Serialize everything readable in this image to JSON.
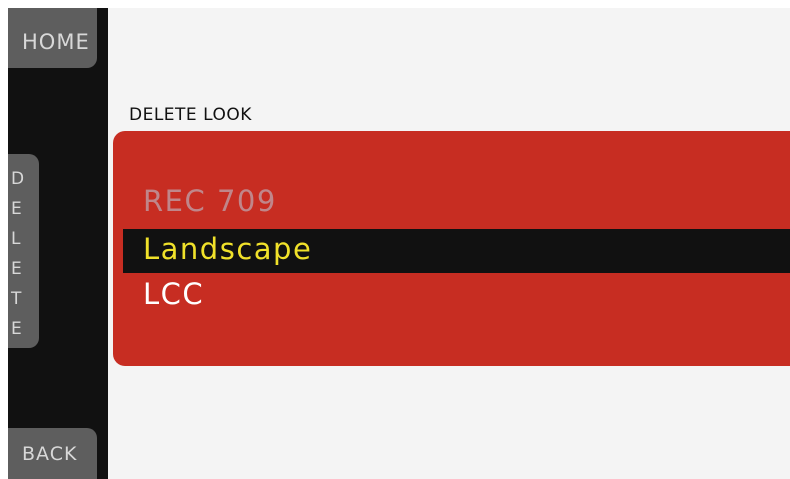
{
  "sidebar": {
    "home_label": "HOME",
    "delete_letters": [
      "D",
      "E",
      "L",
      "E",
      "T",
      "E"
    ],
    "back_label": "BACK"
  },
  "page": {
    "title": "DELETE LOOK"
  },
  "looks": {
    "items": [
      {
        "label": "REC 709",
        "state": "disabled"
      },
      {
        "label": "Landscape",
        "state": "selected"
      },
      {
        "label": "LCC",
        "state": "normal"
      }
    ]
  },
  "colors": {
    "panel_red": "#c72d22",
    "selected_text": "#f0e12a",
    "disabled_text": "#c0868a",
    "sidebar_bg": "#111111",
    "button_gray": "#5e5e5e",
    "screen_bg": "#f4f4f4"
  }
}
